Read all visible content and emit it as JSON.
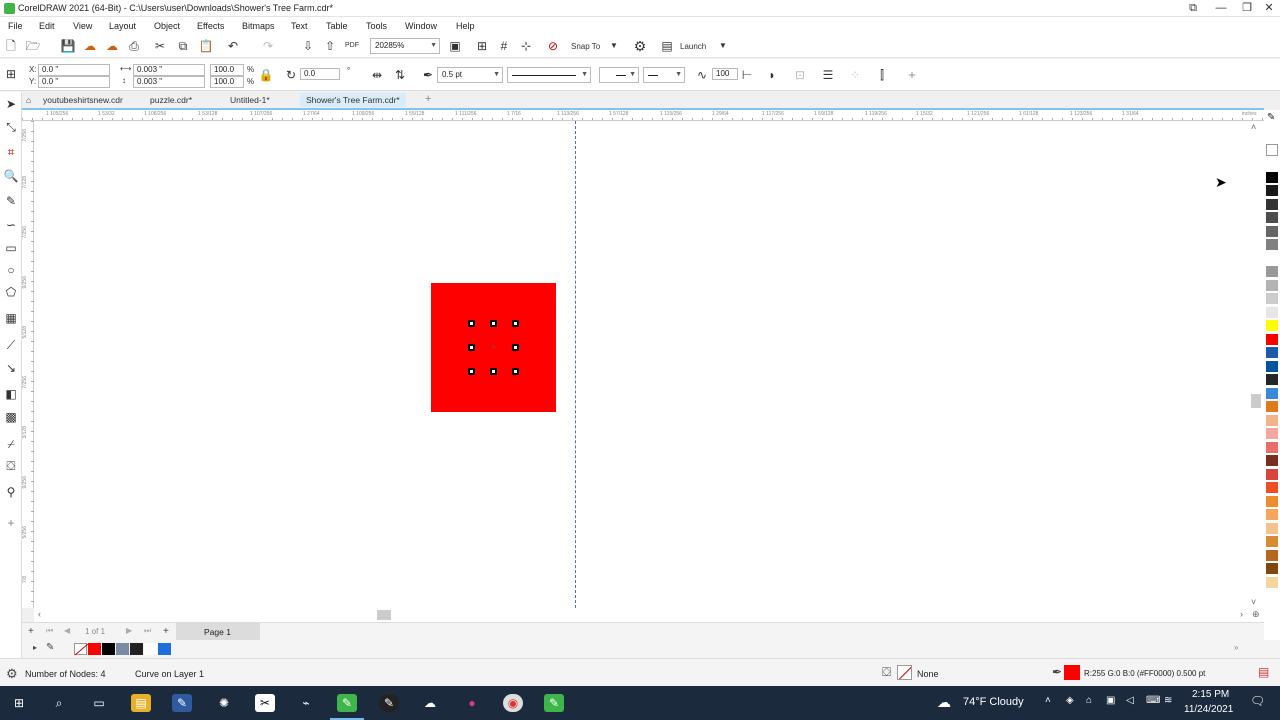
{
  "window": {
    "title": "CorelDRAW 2021 (64-Bit) - C:\\Users\\user\\Downloads\\Shower's Tree Farm.cdr*",
    "minimize": "—",
    "restore": "❐",
    "close": "✕",
    "extra": "⧉"
  },
  "menu": [
    "File",
    "Edit",
    "View",
    "Layout",
    "Object",
    "Effects",
    "Bitmaps",
    "Text",
    "Table",
    "Tools",
    "Window",
    "Help"
  ],
  "toolbar": {
    "zoom": "20285%",
    "snap_to": "Snap To",
    "launch": "Launch"
  },
  "property_bar": {
    "x_label": "X:",
    "x": "0.0 \"",
    "y_label": "Y:",
    "y": "0.0 \"",
    "w": "0.003 \"",
    "h": "0.003 \"",
    "scale_w": "100.0",
    "scale_h": "100.0",
    "pct": "%",
    "rotation": "0.0",
    "rotation_unit": "°",
    "outline_width": "0.5 pt",
    "smoothing": "100"
  },
  "tabs": [
    "youtubeshirtsnew.cdr",
    "puzzle.cdr*",
    "Untitled-1*",
    "Shower's Tree Farm.cdr*"
  ],
  "ruler_h": [
    "1 105/256",
    "1 53/32",
    "1 106/256",
    "1 53/128",
    "1 107/256",
    "1 27/64",
    "1 109/256",
    "1 55/128",
    "1 111/256",
    "1 7/16",
    "1 113/256",
    "1 57/128",
    "1 115/256",
    "1 29/64",
    "1 117/256",
    "1 59/128",
    "1 119/256",
    "1 15/32",
    "1 121/256",
    "1 61/128",
    "1 123/256",
    "1 31/64"
  ],
  "ruler_unit": "inches",
  "ruler_v": [
    "7/256",
    "7/128",
    "7/256",
    "9/256",
    "5/128",
    "7/256",
    "3/128",
    "9/256",
    "5/256",
    "7/8"
  ],
  "page_nav": {
    "page_of": "1   of 1",
    "page_tab": "Page 1"
  },
  "status": {
    "nodes": "Number of Nodes: 4",
    "layer": "Curve on Layer 1",
    "fill": "None",
    "outline": "R:255 G:0 B:0 (#FF0000)  0.500 pt"
  },
  "taskbar": {
    "weather": "74°F  Cloudy",
    "time": "2:15 PM",
    "date": "11/24/2021"
  },
  "colors": {
    "accent": "#7ec4ee",
    "rect_fill": "#ff0000",
    "taskbar": "#1c2a3d"
  },
  "palette": [
    "#ffffff",
    "#000000",
    "#1a1a1a",
    "#333333",
    "#4d4d4d",
    "#666666",
    "#808080",
    "#ffffff",
    "#999999",
    "#b3b3b3",
    "#cccccc",
    "#e6e6e6",
    "#ffff00",
    "#ff0000",
    "#1e5aa8",
    "#00549f",
    "#262626",
    "#3b8ad9",
    "#e07a1f",
    "#f2b38a",
    "#f5a7a1",
    "#ea6f6a",
    "#7a2e1f",
    "#d9453a",
    "#f04e23",
    "#ef8c2d",
    "#f7a45c",
    "#f5c28f",
    "#d98a33",
    "#b5671d",
    "#7c4a0f",
    "#f5d6a0"
  ],
  "doc_palette": [
    "none",
    "#ff0000",
    "#000000",
    "#7a8aa0",
    "#222222",
    "#ffffff",
    "#1e6fd9"
  ]
}
